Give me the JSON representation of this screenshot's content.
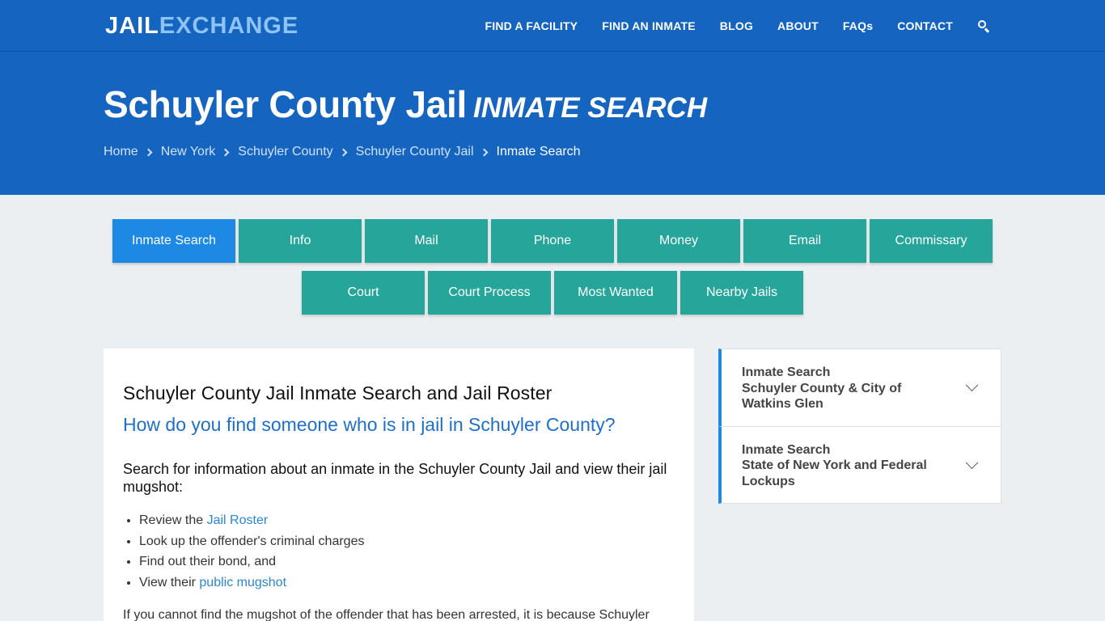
{
  "header": {
    "logo_part1": "JAIL",
    "logo_part2": "EXCHANGE",
    "nav": [
      "FIND A FACILITY",
      "FIND AN INMATE",
      "BLOG",
      "ABOUT",
      "FAQs",
      "CONTACT"
    ],
    "search_icon": "search-icon"
  },
  "hero": {
    "title": "Schuyler County Jail",
    "subtitle": "INMATE SEARCH",
    "breadcrumbs": [
      "Home",
      "New York",
      "Schuyler County",
      "Schuyler County Jail"
    ],
    "breadcrumb_current": "Inmate Search"
  },
  "tabs": {
    "row1": [
      "Inmate Search",
      "Info",
      "Mail",
      "Phone",
      "Money",
      "Email",
      "Commissary"
    ],
    "row2": [
      "Court",
      "Court Process",
      "Most Wanted",
      "Nearby Jails"
    ],
    "active": "Inmate Search"
  },
  "main": {
    "heading": "Schuyler County Jail Inmate Search and Jail Roster",
    "question": "How do you find someone who is in jail in Schuyler County?",
    "intro": "Search for information about an inmate in the Schuyler County Jail and view their jail mugshot:",
    "list": [
      {
        "pre": "Review the ",
        "link": "Jail Roster",
        "post": ""
      },
      {
        "pre": "Look up the offender's criminal charges",
        "link": "",
        "post": ""
      },
      {
        "pre": "Find out their bond, and",
        "link": "",
        "post": ""
      },
      {
        "pre": "View their ",
        "link": "public mugshot",
        "post": ""
      }
    ],
    "paragraph": "If you cannot find the mugshot of the offender that has been arrested, it is because Schuyler"
  },
  "sidebar": {
    "items": [
      {
        "line1": "Inmate Search",
        "line2": "Schuyler County & City of Watkins Glen"
      },
      {
        "line1": "Inmate Search",
        "line2": "State of New York and Federal Lockups"
      }
    ]
  },
  "colors": {
    "brand_blue": "#1565c0",
    "logo_accent": "#8ec3f5",
    "tab_teal": "#26a69a",
    "tab_active": "#1e88e5",
    "link_blue": "#2a86d6"
  }
}
